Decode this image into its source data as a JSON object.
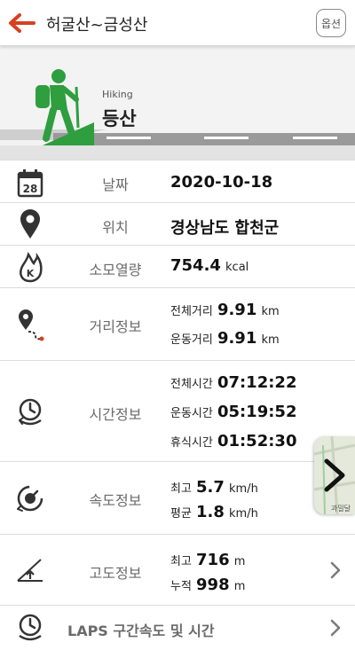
{
  "header": {
    "title": "허굴산~금성산",
    "option_label": "옵션"
  },
  "hero": {
    "activity_en": "Hiking",
    "activity_ko": "등산"
  },
  "date": {
    "label": "날짜",
    "value": "2020-10-18",
    "calendar_day": "28"
  },
  "location": {
    "label": "위치",
    "value": "경상남도 합천군"
  },
  "calories": {
    "label": "소모열량",
    "value": "754.4",
    "unit": "kcal"
  },
  "distance": {
    "label": "거리정보",
    "total_label": "전체거리",
    "total_value": "9.91",
    "total_unit": "km",
    "moving_label": "운동거리",
    "moving_value": "9.91",
    "moving_unit": "km"
  },
  "time": {
    "label": "시간정보",
    "total_label": "전체시간",
    "total_value": "07:12:22",
    "moving_label": "운동시간",
    "moving_value": "05:19:52",
    "rest_label": "휴식시간",
    "rest_value": "01:52:30"
  },
  "speed": {
    "label": "속도정보",
    "max_label": "최고",
    "max_value": "5.7",
    "max_unit": "km/h",
    "avg_label": "평균",
    "avg_value": "1.8",
    "avg_unit": "km/h"
  },
  "altitude": {
    "label": "고도정보",
    "max_label": "최고",
    "max_value": "716",
    "max_unit": "m",
    "cum_label": "누적",
    "cum_value": "998",
    "cum_unit": "m"
  },
  "laps": {
    "label": "LAPS 구간속도 및 시간"
  },
  "map_tab": {
    "text": "과밀달"
  },
  "colors": {
    "accent": "#d6401f",
    "green": "#2e9e3e",
    "label_gray": "#6a6a6a"
  }
}
